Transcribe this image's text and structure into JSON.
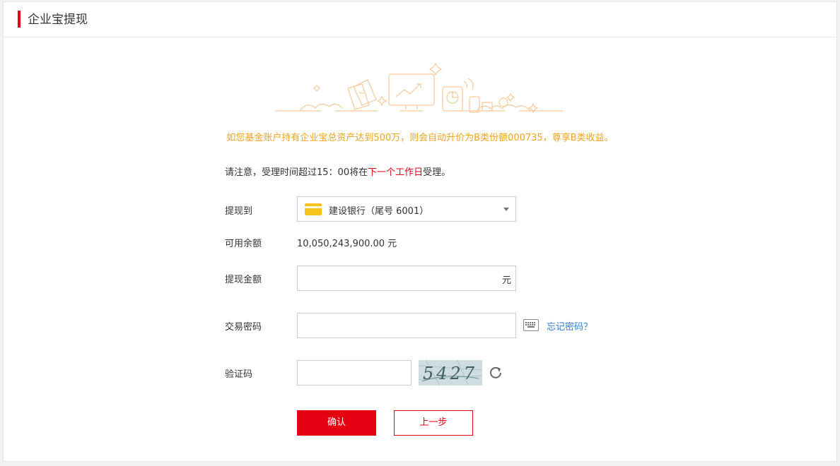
{
  "header": {
    "title": "企业宝提现"
  },
  "notice": "如您基金账户持有企业宝总资产达到500万，则会自动升价为B类份额000735，尊享B类收益。",
  "note": {
    "prefix": "请注意，受理时间超过15：00将在",
    "highlight": "下一个工作日",
    "suffix": "受理。"
  },
  "form": {
    "withdraw_to_label": "提现到",
    "bank_selected": "建设银行（尾号 6001）",
    "available_label": "可用余额",
    "available_value": "10,050,243,900.00 元",
    "amount_label": "提现金额",
    "amount_value": "",
    "amount_unit": "元",
    "password_label": "交易密码",
    "password_value": "",
    "forgot_link": "忘记密码？",
    "captcha_label": "验证码",
    "captcha_value": "",
    "captcha_image_text": "5427"
  },
  "buttons": {
    "confirm": "确认",
    "prev": "上一步"
  },
  "colors": {
    "accent": "#e50012",
    "notice": "#f0a41a",
    "link": "#2f7fd6"
  },
  "icons": [
    "bank-card-icon",
    "chevron-down-icon",
    "keyboard-icon",
    "refresh-icon"
  ]
}
